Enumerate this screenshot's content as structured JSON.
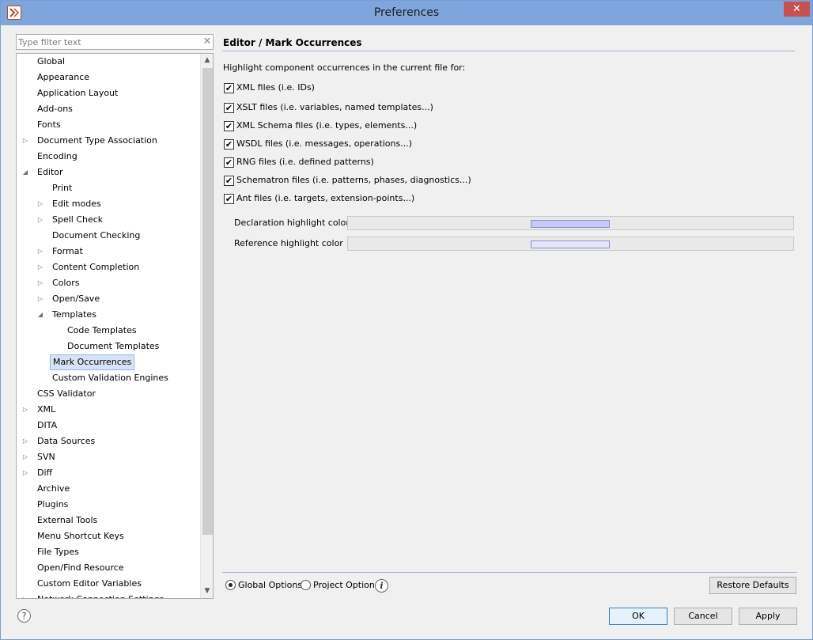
{
  "window": {
    "title": "Preferences",
    "close_glyph": "✕"
  },
  "filter": {
    "placeholder": "Type filter text",
    "clear_glyph": "✕"
  },
  "tree": [
    {
      "label": "Global",
      "level": 0,
      "toggle": ""
    },
    {
      "label": "Appearance",
      "level": 0,
      "toggle": ""
    },
    {
      "label": "Application Layout",
      "level": 0,
      "toggle": ""
    },
    {
      "label": "Add-ons",
      "level": 0,
      "toggle": ""
    },
    {
      "label": "Fonts",
      "level": 0,
      "toggle": ""
    },
    {
      "label": "Document Type Association",
      "level": 0,
      "toggle": "collapsed"
    },
    {
      "label": "Encoding",
      "level": 0,
      "toggle": ""
    },
    {
      "label": "Editor",
      "level": 0,
      "toggle": "expanded"
    },
    {
      "label": "Print",
      "level": 1,
      "toggle": ""
    },
    {
      "label": "Edit modes",
      "level": 1,
      "toggle": "collapsed"
    },
    {
      "label": "Spell Check",
      "level": 1,
      "toggle": "collapsed"
    },
    {
      "label": "Document Checking",
      "level": 1,
      "toggle": ""
    },
    {
      "label": "Format",
      "level": 1,
      "toggle": "collapsed"
    },
    {
      "label": "Content Completion",
      "level": 1,
      "toggle": "collapsed"
    },
    {
      "label": "Colors",
      "level": 1,
      "toggle": "collapsed"
    },
    {
      "label": "Open/Save",
      "level": 1,
      "toggle": "collapsed"
    },
    {
      "label": "Templates",
      "level": 1,
      "toggle": "expanded"
    },
    {
      "label": "Code Templates",
      "level": 2,
      "toggle": ""
    },
    {
      "label": "Document Templates",
      "level": 2,
      "toggle": ""
    },
    {
      "label": "Mark Occurrences",
      "level": 1,
      "toggle": "",
      "selected": true
    },
    {
      "label": "Custom Validation Engines",
      "level": 1,
      "toggle": ""
    },
    {
      "label": "CSS Validator",
      "level": 0,
      "toggle": ""
    },
    {
      "label": "XML",
      "level": 0,
      "toggle": "collapsed"
    },
    {
      "label": "DITA",
      "level": 0,
      "toggle": ""
    },
    {
      "label": "Data Sources",
      "level": 0,
      "toggle": "collapsed"
    },
    {
      "label": "SVN",
      "level": 0,
      "toggle": "collapsed"
    },
    {
      "label": "Diff",
      "level": 0,
      "toggle": "collapsed"
    },
    {
      "label": "Archive",
      "level": 0,
      "toggle": ""
    },
    {
      "label": "Plugins",
      "level": 0,
      "toggle": ""
    },
    {
      "label": "External Tools",
      "level": 0,
      "toggle": ""
    },
    {
      "label": "Menu Shortcut Keys",
      "level": 0,
      "toggle": ""
    },
    {
      "label": "File Types",
      "level": 0,
      "toggle": ""
    },
    {
      "label": "Open/Find Resource",
      "level": 0,
      "toggle": ""
    },
    {
      "label": "Custom Editor Variables",
      "level": 0,
      "toggle": ""
    },
    {
      "label": "Network Connection Settings",
      "level": 0,
      "toggle": "collapsed"
    }
  ],
  "scrollbar": {
    "up_glyph": "▲",
    "down_glyph": "▼"
  },
  "panel": {
    "title": "Editor / Mark Occurrences",
    "intro": "Highlight component occurrences in the current file for:",
    "checkboxes": [
      {
        "label": "XML files (i.e. IDs)",
        "checked": true
      },
      {
        "label": "XSLT files (i.e. variables, named templates...)",
        "checked": true
      },
      {
        "label": "XML Schema files (i.e. types, elements...)",
        "checked": true
      },
      {
        "label": "WSDL files (i.e. messages, operations...)",
        "checked": true
      },
      {
        "label": "RNG files (i.e. defined patterns)",
        "checked": true
      },
      {
        "label": "Schematron files (i.e. patterns, phases, diagnostics...)",
        "checked": true
      },
      {
        "label": "Ant files (i.e. targets, extension-points...)",
        "checked": true
      }
    ],
    "colors": [
      {
        "label": "Declaration highlight color",
        "swatch": "#c8c8f4"
      },
      {
        "label": "Reference highlight color",
        "swatch": "#e6e6f8"
      }
    ],
    "check_glyph": "✔"
  },
  "options": {
    "global_label": "Global Options",
    "project_label": "Project Options",
    "info_glyph": "i",
    "selected": "global"
  },
  "buttons": {
    "restore": "Restore Defaults",
    "ok": "OK",
    "cancel": "Cancel",
    "apply": "Apply",
    "help_glyph": "?"
  },
  "colors": {
    "titlebar": "#7ea6dd",
    "close": "#c75050",
    "selection": "#d4e3f6"
  }
}
